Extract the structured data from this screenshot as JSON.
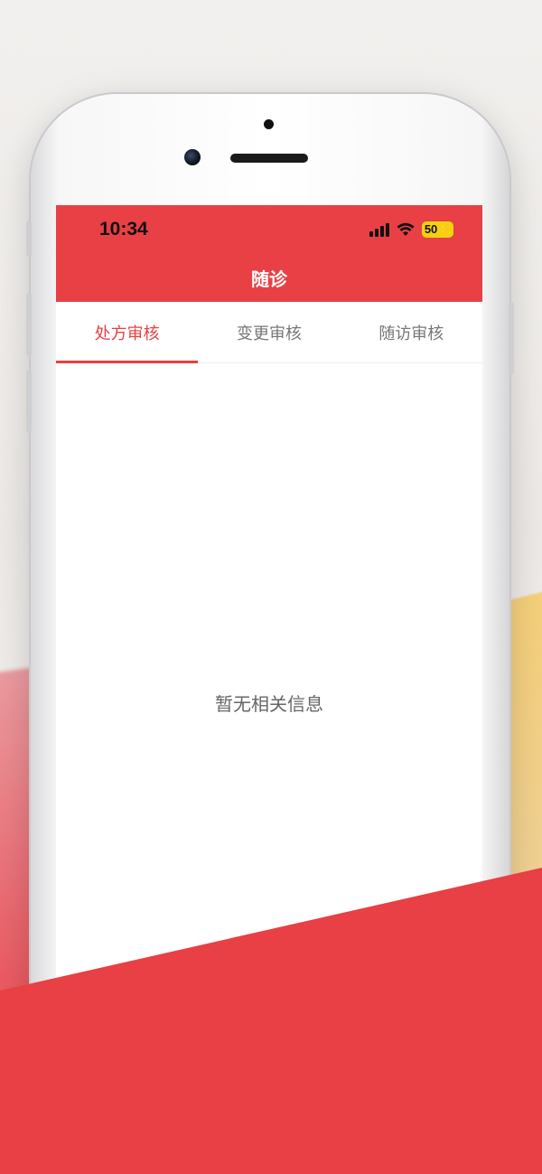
{
  "status_bar": {
    "time": "10:34",
    "battery": "50",
    "icons": [
      "signal-icon",
      "wifi-icon",
      "battery-charging-icon"
    ]
  },
  "header": {
    "title": "随诊",
    "color": "#e84044"
  },
  "tabs": [
    {
      "label": "处方审核",
      "active": true
    },
    {
      "label": "变更审核",
      "active": false
    },
    {
      "label": "随访审核",
      "active": false
    }
  ],
  "main": {
    "empty_text": "暂无相关信息"
  },
  "colors": {
    "accent": "#e84044",
    "battery": "#f6d10f",
    "background_accent_yellow": "#f6cd6e"
  }
}
